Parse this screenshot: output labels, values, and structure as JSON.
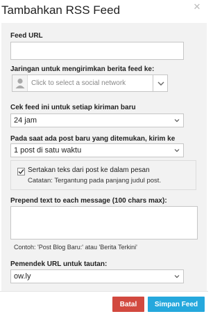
{
  "dialog": {
    "title": "Tambahkan RSS Feed"
  },
  "form": {
    "feed_url": {
      "label": "Feed URL",
      "value": ""
    },
    "network": {
      "label": "Jaringan untuk mengirimkan berita feed ke:",
      "placeholder": "Click to select a social network"
    },
    "check_interval": {
      "label": "Cek feed ini untuk setiap kiriman baru",
      "value": "24 jam"
    },
    "post_count": {
      "label": "Pada saat ada post baru yang ditemukan, kirim ke",
      "value": "1 post di satu waktu"
    },
    "include_text": {
      "label": "Sertakan teks dari post ke dalam pesan",
      "note": "Catatan: Tergantung pada panjang judul post.",
      "checked": true
    },
    "prepend": {
      "label": "Prepend text to each message (100 chars max):",
      "value": "",
      "example": "Contoh: 'Post Blog Baru:' atau 'Berita Terkini'"
    },
    "shortener": {
      "label": "Pemendek URL untuk tautan:",
      "value": "ow.ly"
    }
  },
  "buttons": {
    "cancel": "Batal",
    "save": "Simpan Feed"
  },
  "colors": {
    "cancel": "#d2493f",
    "save": "#25a8dd"
  }
}
